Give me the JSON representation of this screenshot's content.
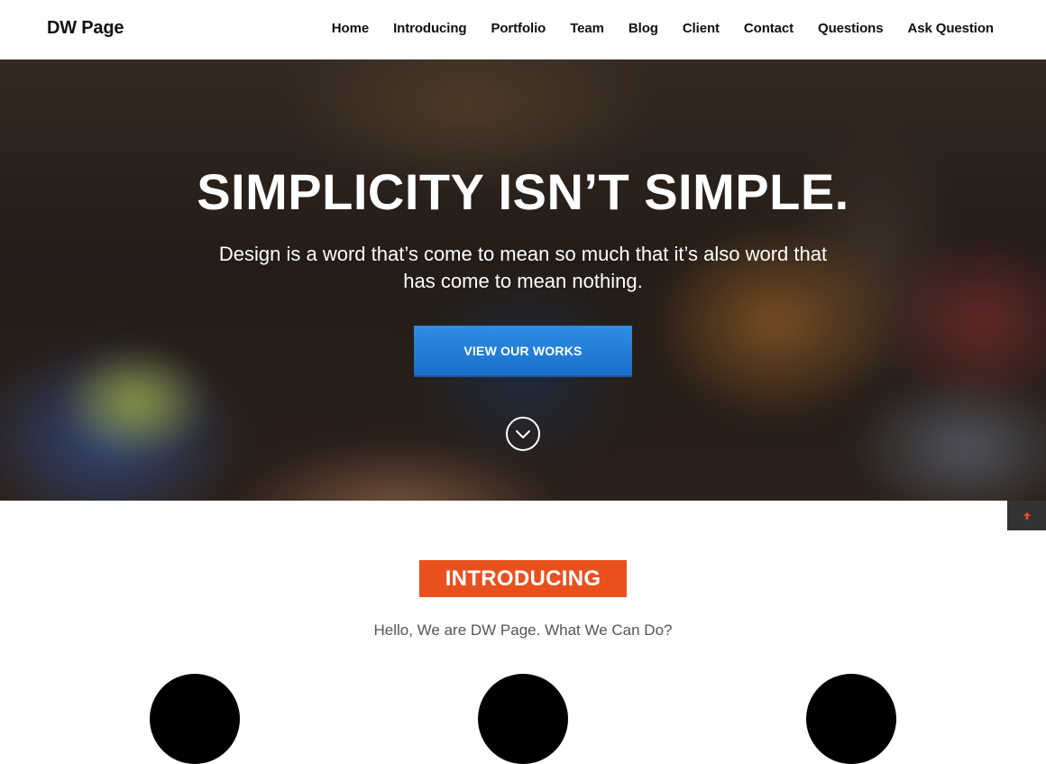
{
  "header": {
    "brand": "DW Page",
    "nav": [
      {
        "label": "Home"
      },
      {
        "label": "Introducing"
      },
      {
        "label": "Portfolio"
      },
      {
        "label": "Team"
      },
      {
        "label": "Blog"
      },
      {
        "label": "Client"
      },
      {
        "label": "Contact"
      },
      {
        "label": "Questions"
      },
      {
        "label": "Ask Question"
      }
    ]
  },
  "hero": {
    "title": "SIMPLICITY ISN’T SIMPLE.",
    "subtitle": "Design is a word that’s come to mean so much that it’s also word that has come to mean nothing.",
    "button_label": "VIEW OUR WORKS",
    "scroll_icon": "chevron-down-icon"
  },
  "back_to_top": {
    "icon": "arrow-up-icon",
    "color": "#e8501e"
  },
  "intro": {
    "badge": "INTRODUCING",
    "subtitle": "Hello, We are DW Page. What We Can Do?"
  },
  "colors": {
    "accent": "#e8501e",
    "button": "#1f7ad6",
    "text": "#111111"
  }
}
